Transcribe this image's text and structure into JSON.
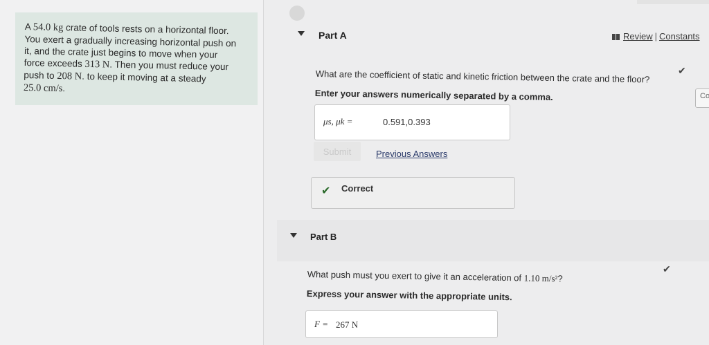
{
  "problem": {
    "line1_pre": "A ",
    "mass": "54.0 kg",
    "line1_post": " crate of tools rests on a horizontal floor.",
    "line2": "You exert a gradually increasing horizontal push on",
    "line3": "it, and the crate just begins to move when your",
    "line4_pre": "force exceeds ",
    "force1": "313 N",
    "line4_post": ". Then you must reduce your",
    "line5_pre": "push to ",
    "force2": "208 N",
    "line5_post": ". to keep it moving at a steady",
    "speed": "25.0 cm/s",
    "line6_post": "."
  },
  "header": {
    "review_label": "Review",
    "separator": "|",
    "constants_label": "Constants"
  },
  "part_a": {
    "title": "Part A",
    "question": "What are the coefficient of static and kinetic friction between the crate and the floor?",
    "instruction": "Enter your answers numerically separated by a comma.",
    "answer_prefix": "μs, μk =",
    "answer_value": "0.591,0.393",
    "submit_label": "Submit",
    "previous_answers_label": "Previous Answers",
    "result_label": "Correct",
    "status_icon": "check-icon"
  },
  "part_b": {
    "title": "Part B",
    "question_pre": "What push must you exert to give it an acceleration of ",
    "acceleration": "1.10 m/s²",
    "question_post": "?",
    "instruction": "Express your answer with the appropriate units.",
    "answer_prefix": "F =",
    "answer_value": "267 N",
    "status_icon": "check-icon"
  },
  "side_tab": {
    "label": "Co"
  },
  "colors": {
    "problem_bg": "#dde7e2",
    "correct_check": "#2b6a2b",
    "link": "#2a3a6a"
  }
}
